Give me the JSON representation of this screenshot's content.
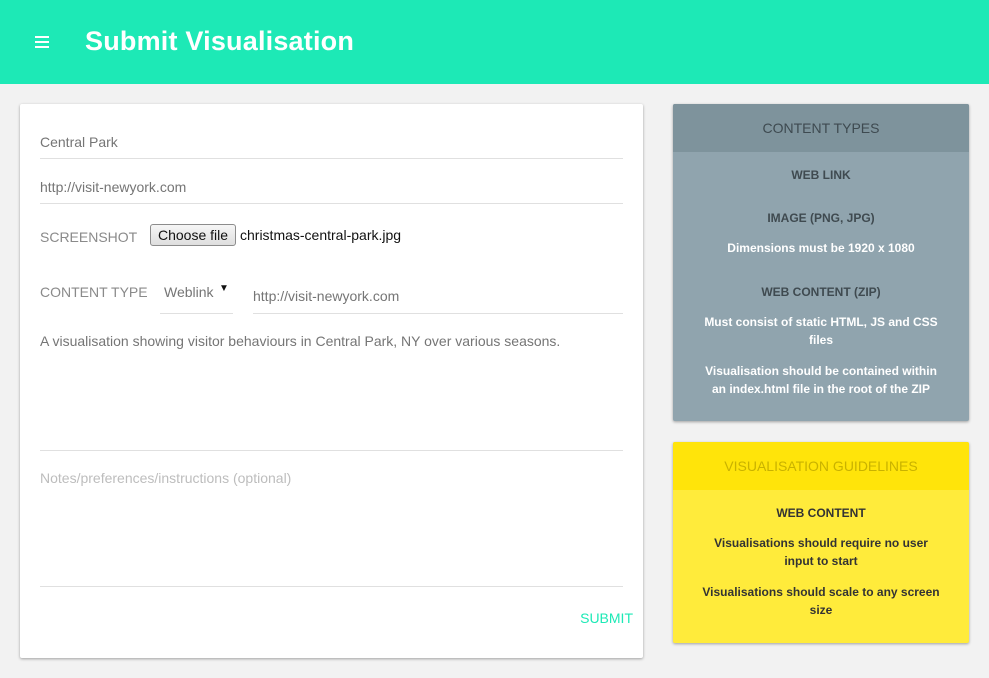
{
  "header": {
    "title": "Submit Visualisation",
    "menu_icon": "hamburger-menu-icon",
    "background": "#1de9b6"
  },
  "form": {
    "title_value": "Central Park",
    "url_value": "http://visit-newyork.com",
    "screenshot_label": "SCREENSHOT",
    "choose_file_label": "Choose file",
    "file_name": "christmas-central-park.jpg",
    "content_type_label": "CONTENT TYPE",
    "content_type_selected": "Weblink",
    "weblink_value": "http://visit-newyork.com",
    "description": "A visualisation showing visitor behaviours in Central Park, NY over various seasons.",
    "notes_placeholder": "Notes/preferences/instructions (optional)",
    "submit_label": "SUBMIT"
  },
  "content_types": {
    "title": "CONTENT TYPES",
    "web_link_heading": "WEB LINK",
    "image_heading": "IMAGE (PNG, JPG)",
    "image_note": "Dimensions must be 1920 x 1080",
    "web_content_heading": "WEB CONTENT (ZIP)",
    "web_content_note_1": "Must consist of static HTML, JS and CSS files",
    "web_content_note_2": "Visualisation should be contained within an index.html file in the root of the ZIP"
  },
  "guidelines": {
    "title": "VISUALISATION GUIDELINES",
    "web_content_heading": "WEB CONTENT",
    "note_1": "Visualisations should require no user input to start",
    "note_2": "Visualisations should scale to any screen size"
  },
  "colors": {
    "accent": "#1de9b6",
    "types_card": "#90a4ae",
    "guidelines_card": "#ffeb3b"
  }
}
